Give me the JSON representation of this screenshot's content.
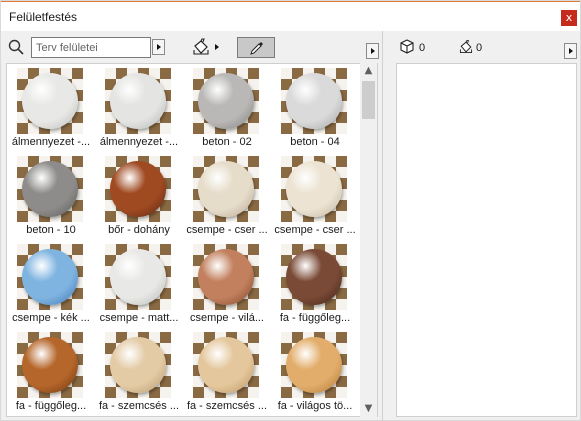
{
  "window": {
    "title": "Felületfestés",
    "close_glyph": "x"
  },
  "toolbar": {
    "search_placeholder": "Terv felületei",
    "search_value": ""
  },
  "counts": {
    "surfaces": "0",
    "painted": "0"
  },
  "materials": [
    {
      "label": "álmennyezet -...",
      "color": "#e8e8e6",
      "shade": "#b8b8b5"
    },
    {
      "label": "álmennyezet -...",
      "color": "#e4e4e2",
      "shade": "#b0b0ae"
    },
    {
      "label": "beton - 02",
      "color": "#b9b8b6",
      "shade": "#7e7d7b"
    },
    {
      "label": "beton - 04",
      "color": "#dadada",
      "shade": "#a2a2a2"
    },
    {
      "label": "beton - 10",
      "color": "#8d8c8a",
      "shade": "#5a5958"
    },
    {
      "label": "bőr - dohány",
      "color": "#a04a22",
      "shade": "#5a2410"
    },
    {
      "label": "csempe - cser ...",
      "color": "#e6dcca",
      "shade": "#b5a68e"
    },
    {
      "label": "csempe - cser ...",
      "color": "#ece3d2",
      "shade": "#bdb09a"
    },
    {
      "label": "csempe - kék ...",
      "color": "#7fb4e0",
      "shade": "#3a73b5"
    },
    {
      "label": "csempe - matt...",
      "color": "#e8e8e6",
      "shade": "#b5b5b2"
    },
    {
      "label": "csempe - vilá...",
      "color": "#c2805e",
      "shade": "#7d4429"
    },
    {
      "label": "fa - függőleg...",
      "color": "#7a4a36",
      "shade": "#3f2116"
    },
    {
      "label": "fa - függőleg...",
      "color": "#b5662a",
      "shade": "#6a340f"
    },
    {
      "label": "fa - szemcsés ...",
      "color": "#e3cba6",
      "shade": "#b49467"
    },
    {
      "label": "fa - szemcsés ...",
      "color": "#e4c79c",
      "shade": "#b8935c"
    },
    {
      "label": "fa - világos tö...",
      "color": "#e2ad6a",
      "shade": "#ad7433"
    }
  ],
  "icons": {
    "search": "search-icon",
    "bucket": "paint-bucket-icon",
    "eyedropper": "eyedropper-icon",
    "cube": "cube-icon"
  },
  "colors": {
    "accent_title_border": "#e07b3a",
    "close_button": "#c42b1c",
    "checker_dark": "#8a6a43"
  }
}
